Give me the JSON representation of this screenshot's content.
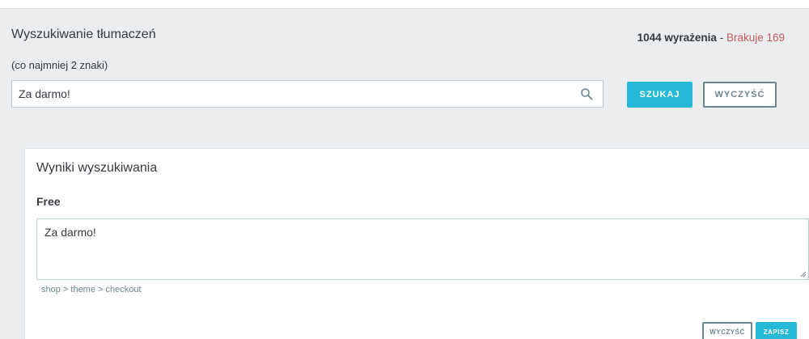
{
  "search": {
    "title": "Wyszukiwanie tłumaczeń",
    "hint": "(co najmniej 2 znaki)",
    "query_value": "Za darmo!",
    "search_button": "SZUKAJ",
    "clear_button": "WYCZYŚĆ"
  },
  "stats": {
    "count": "1044 wyrażenia",
    "separator": " - ",
    "missing": "Brakuje 169"
  },
  "results": {
    "title": "Wyniki wyszukiwania",
    "items": [
      {
        "source": "Free",
        "translation": "Za darmo!",
        "domain_path": "shop > theme > checkout",
        "clear_button": "WYCZYŚĆ",
        "save_button": "ZAPISZ"
      }
    ]
  },
  "colors": {
    "accent": "#25b9d7",
    "missing": "#c05c5c",
    "secondary": "#6c868e",
    "panel_bg": "#ebedef"
  },
  "icons": {
    "search": "search-icon",
    "resize": "resize-grip-icon"
  }
}
